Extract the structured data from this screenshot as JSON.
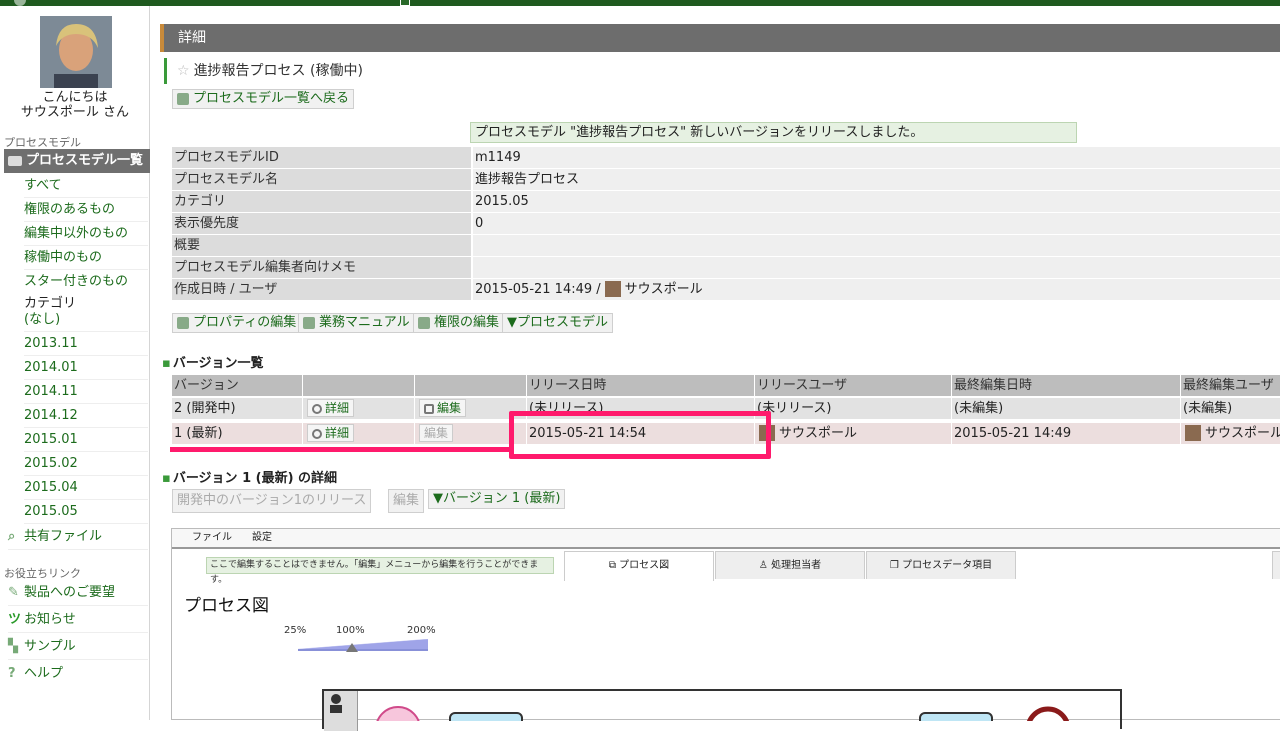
{
  "sidebar": {
    "greeting_line1": "こんにちは",
    "greeting_line2": "サウスポール さん",
    "section_process": "プロセスモデル",
    "active_item": "プロセスモデル一覧",
    "items": [
      "すべて",
      "権限のあるもの",
      "編集中以外のもの",
      "稼働中のもの",
      "スター付きのもの"
    ],
    "category_label": "カテゴリ",
    "categories": [
      "(なし)",
      "2013.11",
      "2014.01",
      "2014.11",
      "2014.12",
      "2015.01",
      "2015.02",
      "2015.04",
      "2015.05"
    ],
    "shared_files": "共有ファイル",
    "section_links": "お役立ちリンク",
    "links": [
      "製品へのご要望",
      "お知らせ",
      "サンプル",
      "ヘルプ"
    ]
  },
  "header": {
    "title": "詳細"
  },
  "process": {
    "title": "進捗報告プロセス (稼働中)",
    "back_button": "プロセスモデル一覧へ戻る",
    "notice": "プロセスモデル \"進捗報告プロセス\" 新しいバージョンをリリースしました。",
    "props": [
      {
        "key": "プロセスモデルID",
        "value": "m1149"
      },
      {
        "key": "プロセスモデル名",
        "value": "進捗報告プロセス"
      },
      {
        "key": "カテゴリ",
        "value": "2015.05"
      },
      {
        "key": "表示優先度",
        "value": "0"
      },
      {
        "key": "概要",
        "value": ""
      },
      {
        "key": "プロセスモデル編集者向けメモ",
        "value": ""
      },
      {
        "key": "作成日時 / ユーザ",
        "value": "2015-05-21 14:49 /",
        "user": "サウスポール"
      }
    ],
    "actions": [
      "プロパティの編集",
      "業務マニュアル",
      "権限の編集",
      "▼プロセスモデル"
    ]
  },
  "versions": {
    "title": "バージョン一覧",
    "headers": [
      "バージョン",
      "",
      "",
      "リリース日時",
      "リリースユーザ",
      "最終編集日時",
      "最終編集ユーザ"
    ],
    "detail_label": "詳細",
    "edit_label": "編集",
    "rows": [
      {
        "version": "2 (開発中)",
        "release_date": "(未リリース)",
        "release_user": "(未リリース)",
        "edit_date": "(未編集)",
        "edit_user": "(未編集)"
      },
      {
        "version": "1 (最新)",
        "release_date": "2015-05-21 14:54",
        "release_user": "サウスポール",
        "edit_date": "2015-05-21 14:49",
        "edit_user": "サウスポール"
      }
    ]
  },
  "version_detail": {
    "title": "バージョン 1 (最新) の詳細",
    "release_button": "開発中のバージョン1のリリース",
    "edit_button": "編集",
    "version_menu": "▼バージョン 1 (最新)"
  },
  "editor": {
    "menu": [
      "ファイル",
      "設定"
    ],
    "hint": "ここで編集することはできません。「編集」メニューから編集を行うことができます。",
    "tabs": [
      "プロセス図",
      "処理担当者",
      "プロセスデータ項目"
    ],
    "canvas_title": "プロセス図",
    "zoom_labels": [
      "25%",
      "100%",
      "200%"
    ]
  },
  "colors": {
    "accent_green": "#1c6b1c",
    "highlight": "#ff1a6c"
  }
}
